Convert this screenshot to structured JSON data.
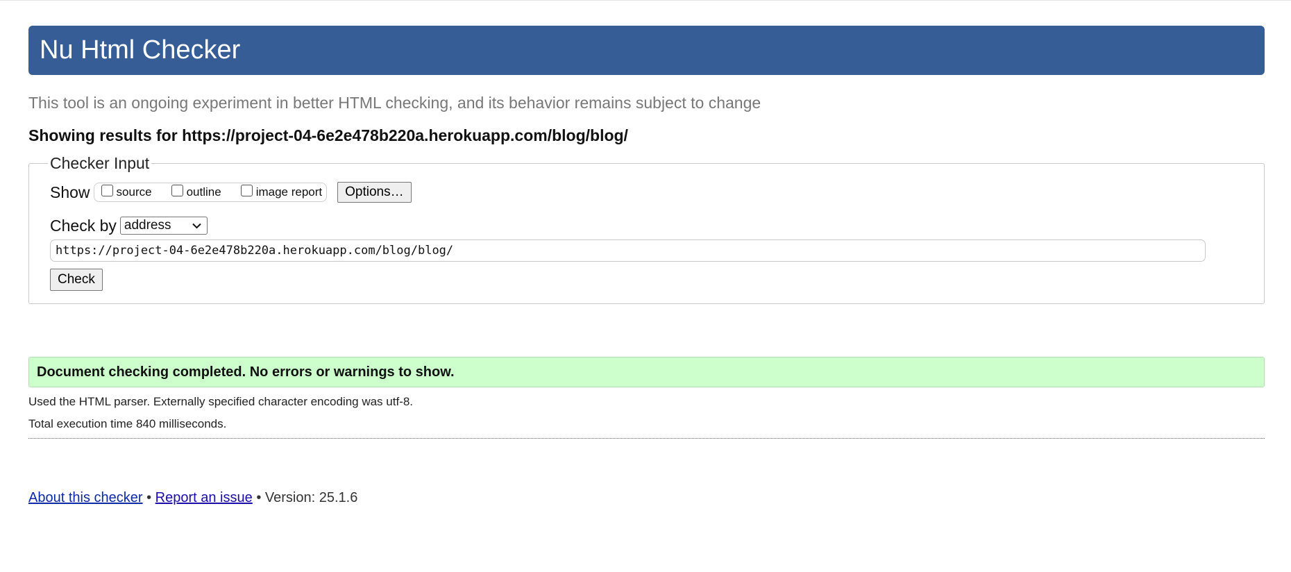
{
  "header": {
    "title": "Nu Html Checker"
  },
  "subtitle": "This tool is an ongoing experiment in better HTML checking, and its behavior remains subject to change",
  "showing": "Showing results for https://project-04-6e2e478b220a.herokuapp.com/blog/blog/",
  "checker_input": {
    "legend": "Checker Input",
    "show_label": "Show",
    "show_options": [
      {
        "label": "source",
        "checked": false
      },
      {
        "label": "outline",
        "checked": false
      },
      {
        "label": "image report",
        "checked": false
      }
    ],
    "options_button": "Options…",
    "check_by_label": "Check by",
    "check_by_value": "address",
    "url_value": "https://project-04-6e2e478b220a.herokuapp.com/blog/blog/",
    "check_button": "Check"
  },
  "result": {
    "message": "Document checking completed. No errors or warnings to show.",
    "color": "#ccffcc"
  },
  "info": {
    "parser": "Used the HTML parser. Externally specified character encoding was utf-8.",
    "time": "Total execution time 840 milliseconds."
  },
  "footer": {
    "about_link": "About this checker",
    "separator": "•",
    "report_link": "Report an issue",
    "version": "Version: 25.1.6"
  },
  "colors": {
    "header_bg": "#365d95",
    "link": "#1a0dab"
  }
}
